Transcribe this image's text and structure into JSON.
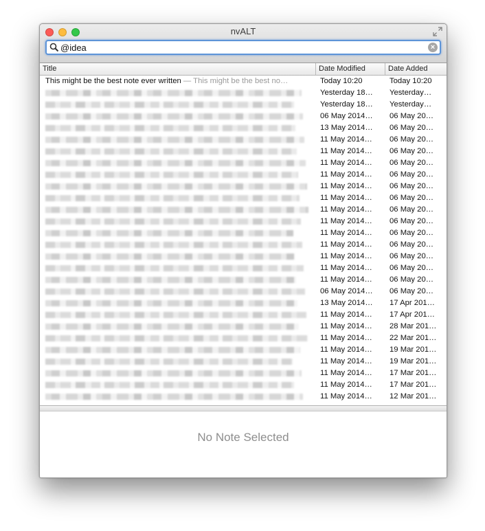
{
  "window": {
    "title": "nvALT"
  },
  "search": {
    "value": "@idea"
  },
  "columns": {
    "title": "Title",
    "date_modified": "Date Modified",
    "date_added": "Date Added"
  },
  "notes": [
    {
      "title": "This might be the best note ever written",
      "preview": " — This might be the best no…",
      "modified": "Today  10:20",
      "added": "Today  10:20"
    },
    {
      "modified": "Yesterday  18…",
      "added": "Yesterday…"
    },
    {
      "modified": "Yesterday  18…",
      "added": "Yesterday…"
    },
    {
      "modified": "06 May 2014…",
      "added": "06 May 20…"
    },
    {
      "modified": "13 May 2014…",
      "added": "06 May 20…"
    },
    {
      "modified": "11 May 2014…",
      "added": "06 May 20…"
    },
    {
      "modified": "11 May 2014…",
      "added": "06 May 20…"
    },
    {
      "modified": "11 May 2014…",
      "added": "06 May 20…"
    },
    {
      "modified": "11 May 2014…",
      "added": "06 May 20…"
    },
    {
      "modified": "11 May 2014…",
      "added": "06 May 20…"
    },
    {
      "modified": "11 May 2014…",
      "added": "06 May 20…"
    },
    {
      "modified": "11 May 2014…",
      "added": "06 May 20…"
    },
    {
      "modified": "11 May 2014…",
      "added": "06 May 20…"
    },
    {
      "modified": "11 May 2014…",
      "added": "06 May 20…"
    },
    {
      "modified": "11 May 2014…",
      "added": "06 May 20…"
    },
    {
      "modified": "11 May 2014…",
      "added": "06 May 20…"
    },
    {
      "modified": "11 May 2014…",
      "added": "06 May 20…"
    },
    {
      "modified": "11 May 2014…",
      "added": "06 May 20…"
    },
    {
      "modified": "06 May 2014…",
      "added": "06 May 20…"
    },
    {
      "modified": "13 May 2014…",
      "added": "17 Apr 201…"
    },
    {
      "modified": "11 May 2014…",
      "added": "17 Apr 201…"
    },
    {
      "modified": "11 May 2014…",
      "added": "28 Mar 201…"
    },
    {
      "modified": "11 May 2014…",
      "added": "22 Mar 201…"
    },
    {
      "modified": "11 May 2014…",
      "added": "19 Mar 201…"
    },
    {
      "modified": "11 May 2014…",
      "added": "19 Mar 201…"
    },
    {
      "modified": "11 May 2014…",
      "added": "17 Mar 201…"
    },
    {
      "modified": "11 May 2014…",
      "added": "17 Mar 201…"
    },
    {
      "modified": "11 May 2014…",
      "added": "12 Mar 201…"
    }
  ],
  "editor": {
    "empty_message": "No Note Selected"
  },
  "colors": {
    "focus_ring": "#5d94d8",
    "close": "#fc5b57",
    "minimize": "#fdbc40",
    "zoom": "#34c84a"
  },
  "icons": {
    "search": "search-icon",
    "clear": "clear-search-icon",
    "fullscreen": "fullscreen-icon"
  }
}
